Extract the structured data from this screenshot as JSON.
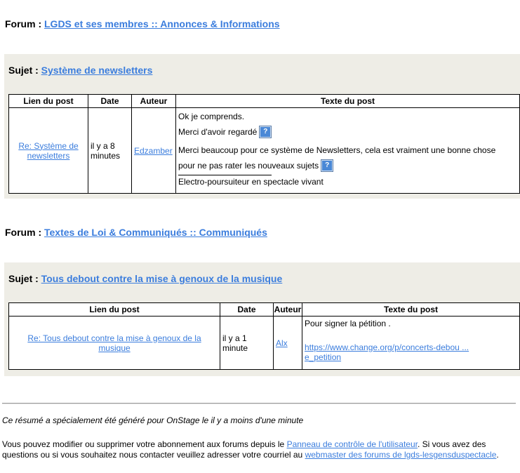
{
  "sections": [
    {
      "forum_label": "Forum :",
      "forum_link": "LGDS et ses membres :: Annonces & Informations",
      "sujet_label": "Sujet :",
      "sujet_link": "Système de newsletters",
      "headers": [
        "Lien du post",
        "Date",
        "Auteur",
        "Texte du post"
      ],
      "row": {
        "link": "Re: Système de newsletters",
        "date": "il y a 8 minutes",
        "author": "Edzamber",
        "text_lines": [
          "Ok je comprends.",
          "Merci d'avoir regardé",
          "Merci beaucoup pour ce système de Newsletters, cela est vraiment une bonne chose",
          "pour ne pas rater les nouveaux sujets"
        ],
        "signature": "Electro-poursuiteur en spectacle vivant"
      }
    },
    {
      "forum_label": "Forum :",
      "forum_link": "Textes de Loi & Communiqués :: Communiqués",
      "sujet_label": "Sujet :",
      "sujet_link": "Tous debout contre la mise à genoux de la musique",
      "headers": [
        "Lien du post",
        "Date",
        "Auteur",
        "Texte du post"
      ],
      "row": {
        "link": "Re: Tous debout contre la mise à genoux de la musique",
        "date": "il y a 1 minute",
        "author": "Alx",
        "text_line": "Pour signer la pétition .",
        "url_line1": "https://www.change.org/p/concerts-debou ...",
        "url_line2": "e_petition"
      }
    }
  ],
  "smiley_icon": "question-smiley-icon",
  "footer": {
    "generated": "Ce résumé a spécialement été généré pour OnStage le il y a moins d'une minute",
    "text_before": "Vous pouvez modifier ou supprimer votre abonnement aux forums depuis le ",
    "control_panel_link": "Panneau de contrôle de l'utilisateur",
    "text_middle": ". Si vous avez des questions ou si vous souhaitez nous contacter veuillez adresser votre courriel au ",
    "webmaster_link": "webmaster des forums de lgds-lesgensduspectacle",
    "text_end": "."
  },
  "colors": {
    "link": "#3b7ddd",
    "panel": "#eeede6"
  }
}
